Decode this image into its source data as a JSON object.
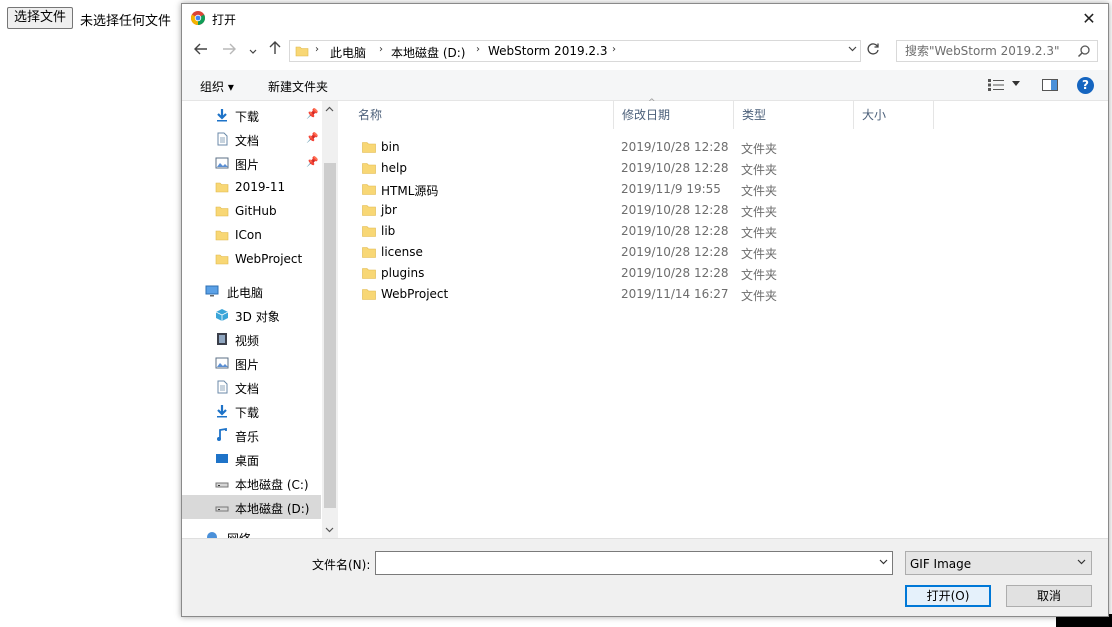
{
  "page": {
    "file_button_label": "选择文件",
    "file_status": "未选择任何文件"
  },
  "dialog": {
    "title": "打开",
    "close_label": "✕",
    "address": {
      "crumbs": [
        "此电脑",
        "本地磁盘 (D:)",
        "WebStorm 2019.2.3"
      ]
    },
    "search": {
      "placeholder": "搜索\"WebStorm 2019.2.3\""
    },
    "toolbar": {
      "organize": "组织 ▾",
      "new_folder": "新建文件夹"
    },
    "help_label": "?",
    "nav": {
      "quick_access": [
        {
          "label": "下载",
          "icon": "download-icon",
          "pinned": true
        },
        {
          "label": "文档",
          "icon": "document-icon",
          "pinned": true
        },
        {
          "label": "图片",
          "icon": "picture-icon",
          "pinned": true
        },
        {
          "label": "2019-11",
          "icon": "folder-icon",
          "pinned": false
        },
        {
          "label": "GitHub",
          "icon": "folder-icon",
          "pinned": false
        },
        {
          "label": "ICon",
          "icon": "folder-icon",
          "pinned": false
        },
        {
          "label": "WebProject",
          "icon": "folder-icon",
          "pinned": false
        }
      ],
      "this_pc": {
        "label": "此电脑",
        "icon": "computer-icon"
      },
      "pc_items": [
        {
          "label": "3D 对象",
          "icon": "cube-icon"
        },
        {
          "label": "视频",
          "icon": "video-icon"
        },
        {
          "label": "图片",
          "icon": "picture-icon"
        },
        {
          "label": "文档",
          "icon": "document-icon"
        },
        {
          "label": "下载",
          "icon": "download-icon"
        },
        {
          "label": "音乐",
          "icon": "music-icon"
        },
        {
          "label": "桌面",
          "icon": "desktop-icon"
        },
        {
          "label": "本地磁盘 (C:)",
          "icon": "drive-icon"
        },
        {
          "label": "本地磁盘 (D:)",
          "icon": "drive-icon",
          "selected": true
        }
      ],
      "network": {
        "label": "网络",
        "icon": "network-icon"
      }
    },
    "columns": {
      "name": "名称",
      "date": "修改日期",
      "type": "类型",
      "size": "大小"
    },
    "files": [
      {
        "name": "bin",
        "date": "2019/10/28 12:28",
        "type": "文件夹"
      },
      {
        "name": "help",
        "date": "2019/10/28 12:28",
        "type": "文件夹"
      },
      {
        "name": "HTML源码",
        "date": "2019/11/9 19:55",
        "type": "文件夹"
      },
      {
        "name": "jbr",
        "date": "2019/10/28 12:28",
        "type": "文件夹"
      },
      {
        "name": "lib",
        "date": "2019/10/28 12:28",
        "type": "文件夹"
      },
      {
        "name": "license",
        "date": "2019/10/28 12:28",
        "type": "文件夹"
      },
      {
        "name": "plugins",
        "date": "2019/10/28 12:28",
        "type": "文件夹"
      },
      {
        "name": "WebProject",
        "date": "2019/11/14 16:27",
        "type": "文件夹"
      }
    ],
    "footer": {
      "filename_label": "文件名(N):",
      "filename_value": "",
      "filetype": "GIF Image",
      "open_label": "打开(O)",
      "cancel_label": "取消"
    },
    "colors": {
      "folder": "#f8d775",
      "accent": "#0078d7",
      "selected_bg": "#d9d9d9",
      "header_text": "#4c607a"
    }
  }
}
